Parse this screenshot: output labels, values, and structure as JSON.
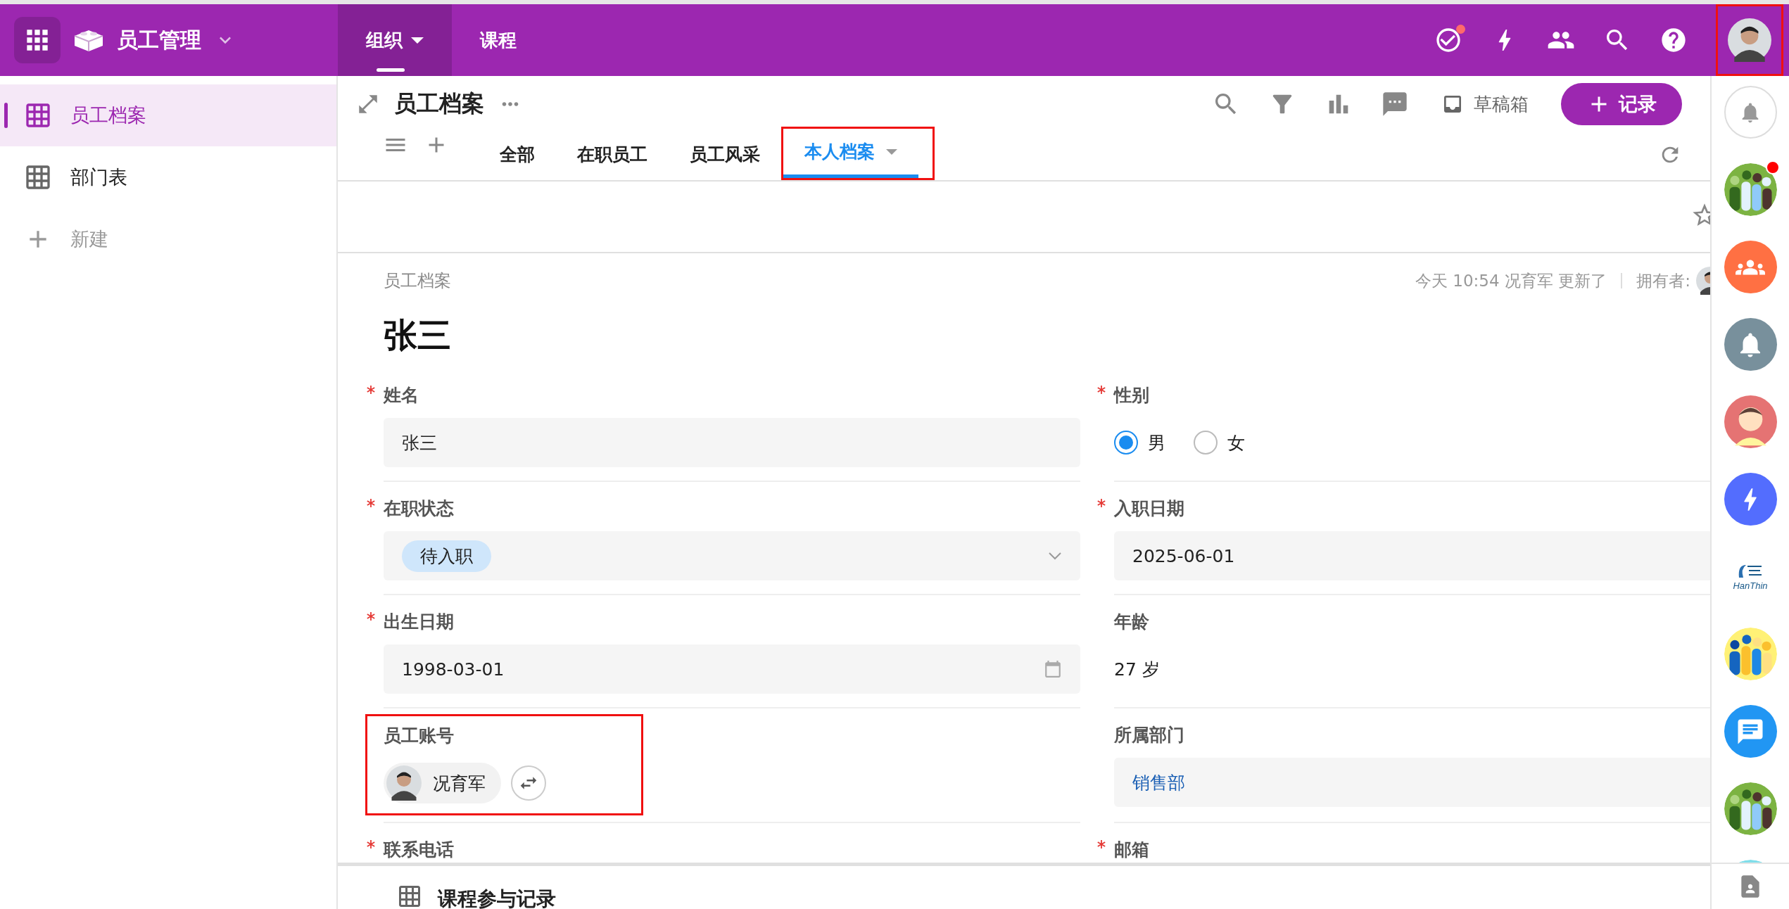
{
  "app_bar": {
    "title": "员工管理",
    "nav": [
      {
        "label": "组织",
        "selected": true,
        "has_menu": true
      },
      {
        "label": "课程",
        "selected": false,
        "has_menu": false
      }
    ],
    "tasks_badge": true,
    "user_highlighted": true
  },
  "sidebar": {
    "items": [
      {
        "label": "员工档案",
        "selected": true
      },
      {
        "label": "部门表",
        "selected": false
      }
    ],
    "new_label": "新建"
  },
  "sheet": {
    "title": "员工档案",
    "drafts": "草稿箱",
    "add_button": "记录",
    "views": [
      {
        "label": "全部",
        "selected": false,
        "highlighted": false
      },
      {
        "label": "在职员工",
        "selected": false,
        "highlighted": false
      },
      {
        "label": "员工风采",
        "selected": false,
        "highlighted": false
      },
      {
        "label": "本人档案",
        "selected": true,
        "highlighted": true
      }
    ]
  },
  "record": {
    "breadcrumb": "员工档案",
    "updated": "今天 10:54 况育军 更新了",
    "owner_label": "拥有者:",
    "title": "张三",
    "fields": [
      {
        "kind": "text",
        "label": "姓名",
        "required": true,
        "value": "张三"
      },
      {
        "kind": "radio",
        "label": "性别",
        "required": true,
        "options": [
          {
            "label": "男",
            "selected": true
          },
          {
            "label": "女",
            "selected": false
          }
        ]
      },
      {
        "kind": "select",
        "label": "在职状态",
        "required": true,
        "value": "待入职"
      },
      {
        "kind": "text",
        "label": "入职日期",
        "required": true,
        "value": "2025-06-01"
      },
      {
        "kind": "date",
        "label": "出生日期",
        "required": true,
        "value": "1998-03-01"
      },
      {
        "kind": "plain",
        "label": "年龄",
        "required": false,
        "value": "27 岁"
      },
      {
        "kind": "user",
        "label": "员工账号",
        "required": false,
        "value": "况育军",
        "highlighted": true
      },
      {
        "kind": "link",
        "label": "所属部门",
        "required": false,
        "value": "销售部"
      },
      {
        "kind": "cut",
        "label": "联系电话",
        "required": true
      },
      {
        "kind": "cut",
        "label": "邮箱",
        "required": true
      }
    ]
  },
  "related": {
    "title": "课程参与记录"
  },
  "rail": [
    {
      "kind": "bell-outline"
    },
    {
      "kind": "picture",
      "badge": true
    },
    {
      "kind": "group"
    },
    {
      "kind": "bell"
    },
    {
      "kind": "person"
    },
    {
      "kind": "bolt"
    },
    {
      "kind": "logo",
      "text": "HanThin"
    },
    {
      "kind": "picture"
    },
    {
      "kind": "chat"
    },
    {
      "kind": "picture"
    },
    {
      "kind": "picture"
    }
  ]
}
